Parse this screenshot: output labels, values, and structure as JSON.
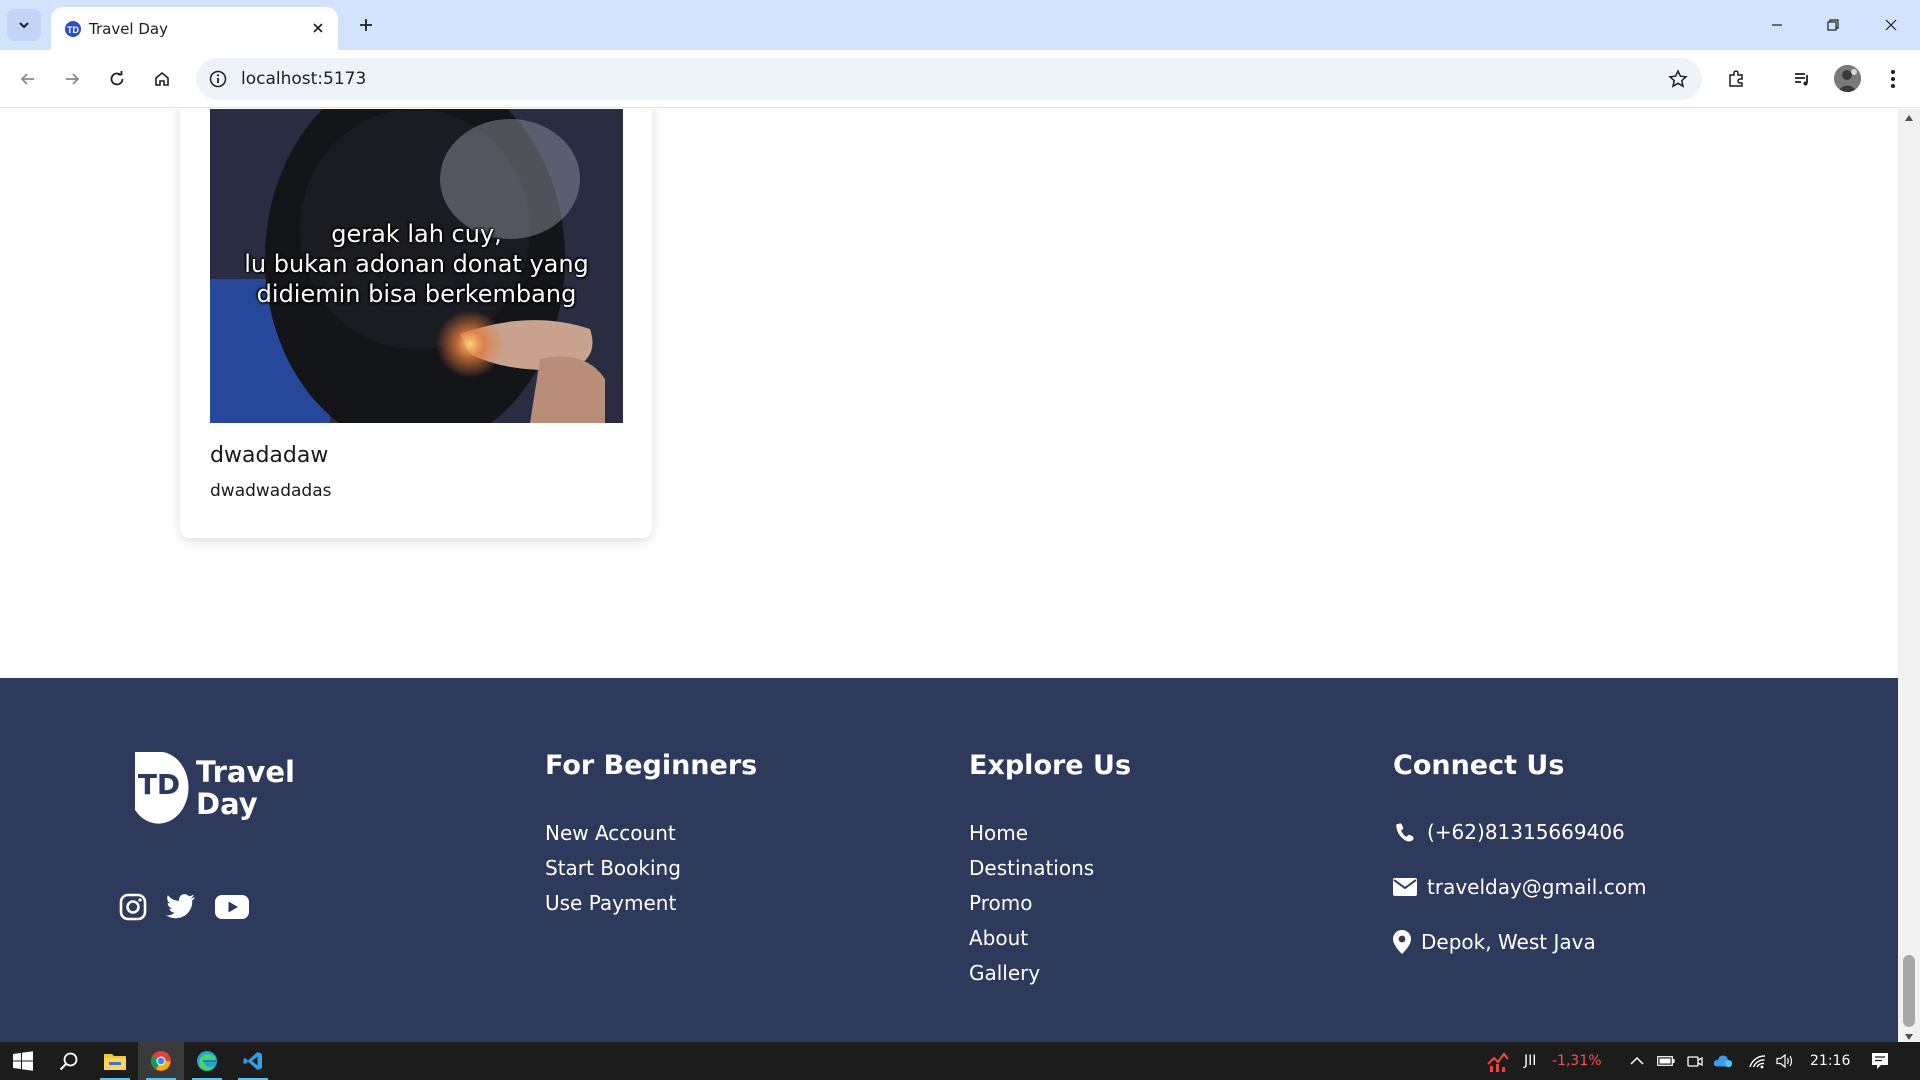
{
  "browser": {
    "tab_title": "Travel Day",
    "url": "localhost:5173",
    "accent_color": "#d3e3fd"
  },
  "card": {
    "image_caption_line1": "gerak lah cuy,",
    "image_caption_line2": "lu bukan adonan donat yang",
    "image_caption_line3": "didiemin bisa berkembang",
    "title": "dwadadaw",
    "description": "dwadwadadas"
  },
  "footer": {
    "background_color": "#2e3a5c",
    "logo": {
      "mark": "TD",
      "line1": "Travel",
      "line2": "Day"
    },
    "social_icons": [
      "instagram-icon",
      "twitter-icon",
      "youtube-icon"
    ],
    "beginners": {
      "title": "For Beginners",
      "links": [
        "New Account",
        "Start Booking",
        "Use Payment"
      ]
    },
    "explore": {
      "title": "Explore Us",
      "links": [
        "Home",
        "Destinations",
        "Promo",
        "About",
        "Gallery"
      ]
    },
    "connect": {
      "title": "Connect Us",
      "phone": "(+62)81315669406",
      "email": "travelday@gmail.com",
      "location": "Depok, West Java"
    }
  },
  "taskbar": {
    "stock_label": "JII",
    "stock_change": "-1,31%",
    "stock_color": "#ff4d4d",
    "time": "21:16"
  }
}
